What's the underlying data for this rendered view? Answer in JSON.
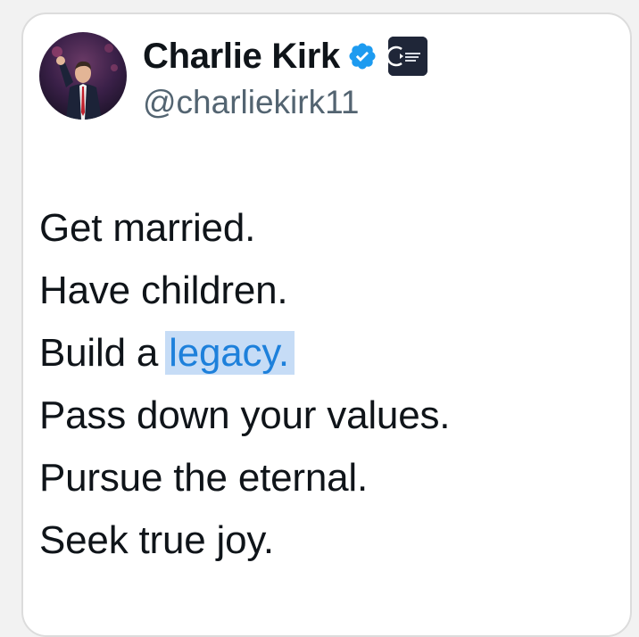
{
  "tweet": {
    "author": {
      "name": "Charlie Kirk",
      "handle": "@charliekirk11",
      "verified": true,
      "verified_color": "#1d9bf0",
      "affiliation_badge": "TURNING POINT USA"
    },
    "lines": [
      "Get married.",
      "Have children.",
      "Build a",
      "Pass down your values.",
      "Pursue the eternal.",
      "Seek true joy."
    ],
    "selected_text": "legacy."
  },
  "colors": {
    "text": "#0f1419",
    "secondary": "#536471",
    "selection_bg": "#c6dcf6",
    "selection_text": "#1d80db"
  },
  "icons": [
    "avatar-photo",
    "verified-badge-icon",
    "affiliation-logo-icon"
  ]
}
